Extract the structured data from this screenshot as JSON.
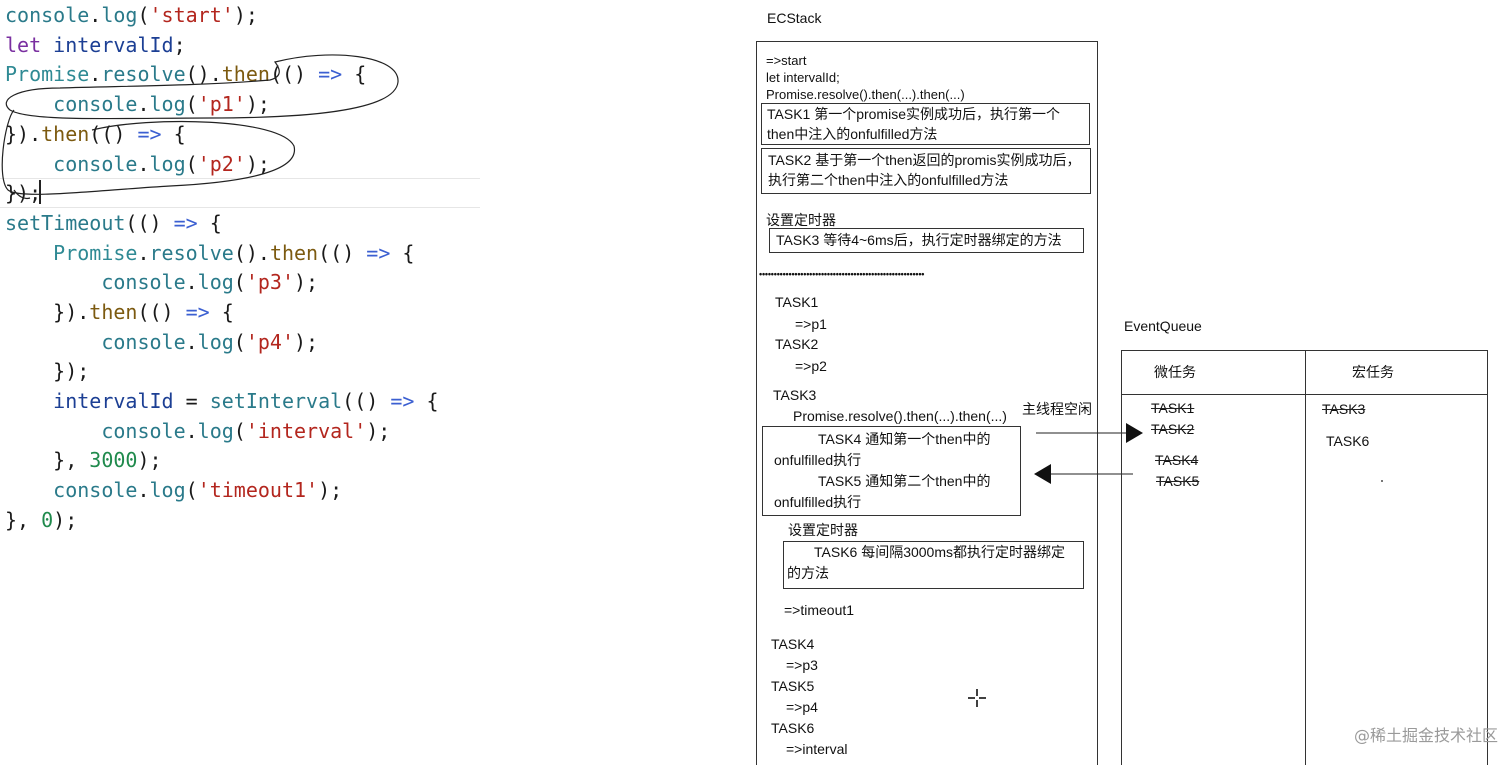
{
  "code": {
    "lines": [
      [
        [
          "console",
          "fn"
        ],
        [
          ".",
          "pn"
        ],
        [
          "log",
          "fn"
        ],
        [
          "(",
          "pn"
        ],
        [
          "'start'",
          "str"
        ],
        [
          ");",
          "pn"
        ]
      ],
      [
        [
          "let",
          "kw"
        ],
        [
          " ",
          "pn"
        ],
        [
          "intervalId",
          "id"
        ],
        [
          ";",
          "pn"
        ]
      ],
      [
        [
          "Promise",
          "cls"
        ],
        [
          ".",
          "pn"
        ],
        [
          "resolve",
          "fn"
        ],
        [
          "().",
          "pn"
        ],
        [
          "then",
          "mt"
        ],
        [
          "(() ",
          "pn"
        ],
        [
          "=>",
          "op"
        ],
        [
          " {",
          "pn"
        ]
      ],
      [
        [
          "    ",
          "pn"
        ],
        [
          "console",
          "fn"
        ],
        [
          ".",
          "pn"
        ],
        [
          "log",
          "fn"
        ],
        [
          "(",
          "pn"
        ],
        [
          "'p1'",
          "str"
        ],
        [
          ");",
          "pn"
        ]
      ],
      [
        [
          "}).",
          "pn"
        ],
        [
          "then",
          "mt"
        ],
        [
          "(() ",
          "pn"
        ],
        [
          "=>",
          "op"
        ],
        [
          " {",
          "pn"
        ]
      ],
      [
        [
          "    ",
          "pn"
        ],
        [
          "console",
          "fn"
        ],
        [
          ".",
          "pn"
        ],
        [
          "log",
          "fn"
        ],
        [
          "(",
          "pn"
        ],
        [
          "'p2'",
          "str"
        ],
        [
          ");",
          "pn"
        ]
      ],
      [
        [
          "});",
          "pn"
        ]
      ],
      [
        [
          "setTimeout",
          "fn"
        ],
        [
          "(() ",
          "pn"
        ],
        [
          "=>",
          "op"
        ],
        [
          " {",
          "pn"
        ]
      ],
      [
        [
          "    ",
          "pn"
        ],
        [
          "Promise",
          "cls"
        ],
        [
          ".",
          "pn"
        ],
        [
          "resolve",
          "fn"
        ],
        [
          "().",
          "pn"
        ],
        [
          "then",
          "mt"
        ],
        [
          "(() ",
          "pn"
        ],
        [
          "=>",
          "op"
        ],
        [
          " {",
          "pn"
        ]
      ],
      [
        [
          "        ",
          "pn"
        ],
        [
          "console",
          "fn"
        ],
        [
          ".",
          "pn"
        ],
        [
          "log",
          "fn"
        ],
        [
          "(",
          "pn"
        ],
        [
          "'p3'",
          "str"
        ],
        [
          ");",
          "pn"
        ]
      ],
      [
        [
          "    }).",
          "pn"
        ],
        [
          "then",
          "mt"
        ],
        [
          "(() ",
          "pn"
        ],
        [
          "=>",
          "op"
        ],
        [
          " {",
          "pn"
        ]
      ],
      [
        [
          "        ",
          "pn"
        ],
        [
          "console",
          "fn"
        ],
        [
          ".",
          "pn"
        ],
        [
          "log",
          "fn"
        ],
        [
          "(",
          "pn"
        ],
        [
          "'p4'",
          "str"
        ],
        [
          ");",
          "pn"
        ]
      ],
      [
        [
          "    });",
          "pn"
        ]
      ],
      [
        [
          "    ",
          "pn"
        ],
        [
          "intervalId",
          "id"
        ],
        [
          " = ",
          "pn"
        ],
        [
          "setInterval",
          "fn"
        ],
        [
          "(() ",
          "pn"
        ],
        [
          "=>",
          "op"
        ],
        [
          " {",
          "pn"
        ]
      ],
      [
        [
          "        ",
          "pn"
        ],
        [
          "console",
          "fn"
        ],
        [
          ".",
          "pn"
        ],
        [
          "log",
          "fn"
        ],
        [
          "(",
          "pn"
        ],
        [
          "'interval'",
          "str"
        ],
        [
          ");",
          "pn"
        ]
      ],
      [
        [
          "    }, ",
          "pn"
        ],
        [
          "3000",
          "num"
        ],
        [
          ");",
          "pn"
        ]
      ],
      [
        [
          "    ",
          "pn"
        ],
        [
          "console",
          "fn"
        ],
        [
          ".",
          "pn"
        ],
        [
          "log",
          "fn"
        ],
        [
          "(",
          "pn"
        ],
        [
          "'timeout1'",
          "str"
        ],
        [
          ");",
          "pn"
        ]
      ],
      [
        [
          "}, ",
          "pn"
        ],
        [
          "0",
          "num"
        ],
        [
          ");",
          "pn"
        ]
      ]
    ]
  },
  "colors": {
    "fn": "#2a7a8a",
    "cls": "#2f8a94",
    "kw": "#7a2fa0",
    "id": "#1c3f94",
    "str": "#b3261e",
    "num": "#1f8a4c",
    "op": "#3b5fd1",
    "pn": "#1a1a1a",
    "mt": "#7c5a10"
  },
  "ecstack": {
    "title": "ECStack",
    "intro": "=>start\nlet intervalId;\nPromise.resolve().then(...).then(...)",
    "task1": "TASK1  第一个promise实例成功后，执行第一个then中注入的onfulfilled方法",
    "task2": "TASK2  基于第一个then返回的promis实例成功后，执行第二个then中注入的onfulfilled方法",
    "timer_label": "设置定时器",
    "task3": "TASK3  等待4~6ms后，执行定时器绑定的方法",
    "dots": "••••••••••••••••••••••••••••••••••••••••••••••••••••••••",
    "task1_run": "TASK1",
    "p1": "=>p1",
    "task2_run": "TASK2",
    "p2": "=>p2",
    "task3_run": "TASK3",
    "promise_line": "Promise.resolve().then(...).then(...)",
    "task4": "TASK4  通知第一个then中的onfulfilled执行",
    "task5": "TASK5  通知第二个then中的onfulfilled执行",
    "timer_label2": "设置定时器",
    "task6": "TASK6  每间隔3000ms都执行定时器绑定的方法",
    "timeout1": "=>timeout1",
    "task4_run": "TASK4",
    "p3": "=>p3",
    "task5_run": "TASK5",
    "p4": "=>p4",
    "task6_run": "TASK6",
    "interval": "=>interval"
  },
  "main_thread_idle": "主线程空闲",
  "eventqueue": {
    "title": "EventQueue",
    "micro_header": "微任务",
    "macro_header": "宏任务",
    "micro_items": [
      "TASK1",
      "TASK2",
      "TASK4",
      "TASK5"
    ],
    "macro_items": [
      "TASK3",
      "TASK6"
    ],
    "micro_done": [
      true,
      true,
      true,
      true
    ],
    "macro_done": [
      true,
      false
    ]
  },
  "watermark": "@稀土掘金技术社区"
}
